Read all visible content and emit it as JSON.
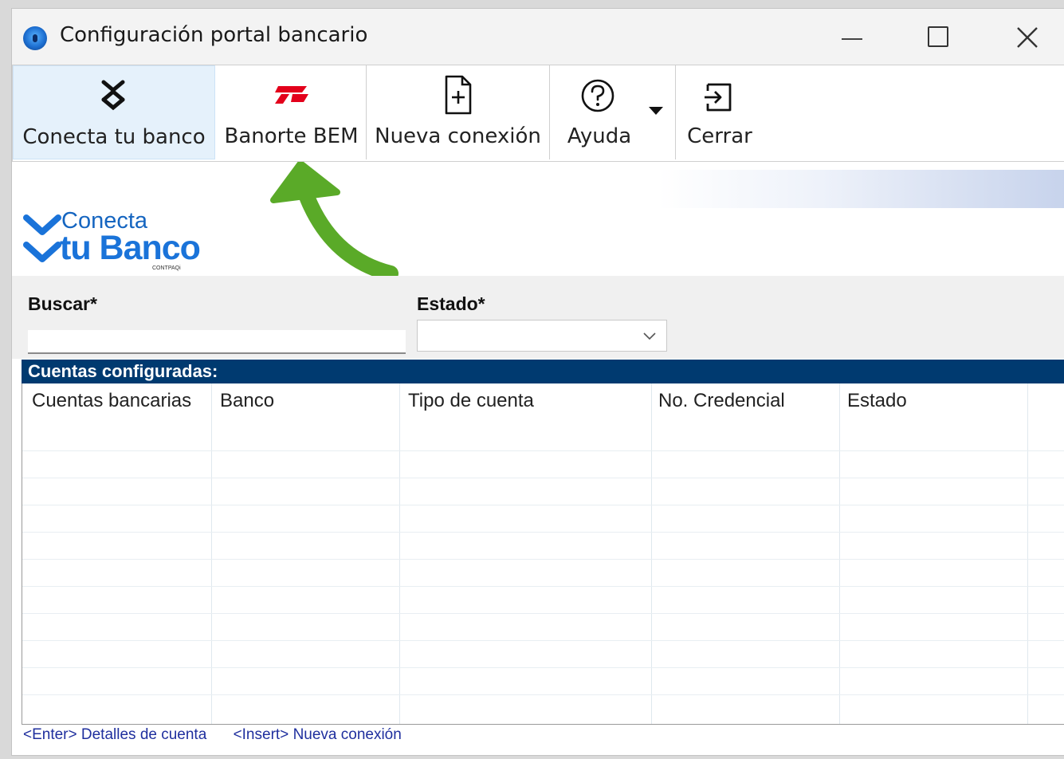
{
  "window": {
    "title": "Configuración portal bancario"
  },
  "toolbar": {
    "items": [
      {
        "label": "Conecta tu banco",
        "icon": "conecta-icon",
        "active": true
      },
      {
        "label": "Banorte BEM",
        "icon": "banorte-icon",
        "active": false
      },
      {
        "label": "Nueva conexión",
        "icon": "new-document-icon",
        "active": false
      },
      {
        "label": "Ayuda",
        "icon": "help-icon",
        "active": false,
        "has_dropdown": true
      },
      {
        "label": "Cerrar",
        "icon": "exit-icon",
        "active": false
      }
    ]
  },
  "logo": {
    "line1": "Conecta",
    "line2": "tu Banco",
    "sub": "CONTPAQi"
  },
  "filters": {
    "buscar_label": "Buscar*",
    "buscar_value": "",
    "estado_label": "Estado*",
    "estado_value": ""
  },
  "grid": {
    "title": "Cuentas configuradas:",
    "columns": [
      "Cuentas bancarias",
      "Banco",
      "Tipo de cuenta",
      "No. Credencial",
      "Estado"
    ],
    "rows": []
  },
  "statusbar": {
    "items": [
      {
        "key": "<Enter>",
        "text": "Detalles de cuenta"
      },
      {
        "key": "<Insert>",
        "text": "Nueva conexión"
      }
    ]
  },
  "colors": {
    "grid_header_bg": "#003a70",
    "active_tab_bg": "#e5f1fb",
    "arrow_green": "#5aaa28",
    "banorte_red": "#e3001b",
    "logo_blue": "#1a73d9"
  }
}
